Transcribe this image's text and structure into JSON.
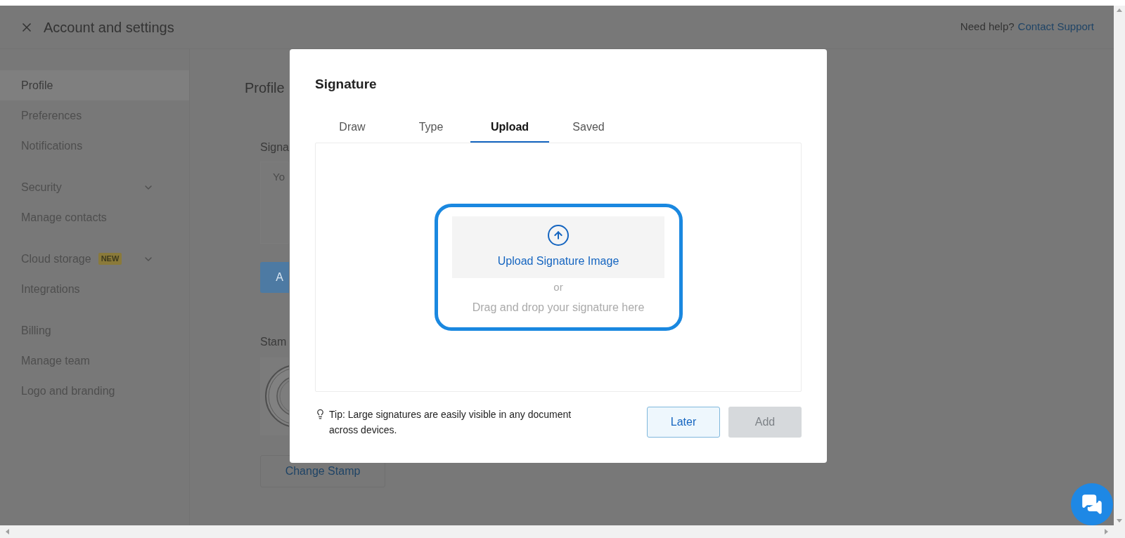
{
  "header": {
    "title": "Account and settings",
    "help_text": "Need help?",
    "help_link": "Contact Support"
  },
  "sidebar": {
    "items": [
      {
        "label": "Profile",
        "selected": true
      },
      {
        "label": "Preferences",
        "selected": false
      },
      {
        "label": "Notifications",
        "selected": false
      },
      {
        "label": "Security",
        "selected": false,
        "expandable": true
      },
      {
        "label": "Manage contacts",
        "selected": false
      },
      {
        "label": "Cloud storage",
        "selected": false,
        "expandable": true,
        "badge": "NEW"
      },
      {
        "label": "Integrations",
        "selected": false
      },
      {
        "label": "Billing",
        "selected": false
      },
      {
        "label": "Manage team",
        "selected": false
      },
      {
        "label": "Logo and branding",
        "selected": false
      }
    ]
  },
  "content": {
    "heading": "Profile",
    "signature_label": "Signa",
    "signature_placeholder": "Yo",
    "add_button": "A",
    "stamp_label": "Stam",
    "change_stamp_button": "Change Stamp"
  },
  "dialog": {
    "title": "Signature",
    "tabs": [
      {
        "label": "Draw",
        "selected": false
      },
      {
        "label": "Type",
        "selected": false
      },
      {
        "label": "Upload",
        "selected": true
      },
      {
        "label": "Saved",
        "selected": false
      }
    ],
    "upload": {
      "button": "Upload Signature Image",
      "or": "or",
      "hint": "Drag and drop your signature here"
    },
    "tip": "Tip: Large signatures are easily visible in any document across devices.",
    "buttons": [
      {
        "label": "Later",
        "disabled": false
      },
      {
        "label": "Add",
        "disabled": true
      }
    ]
  }
}
